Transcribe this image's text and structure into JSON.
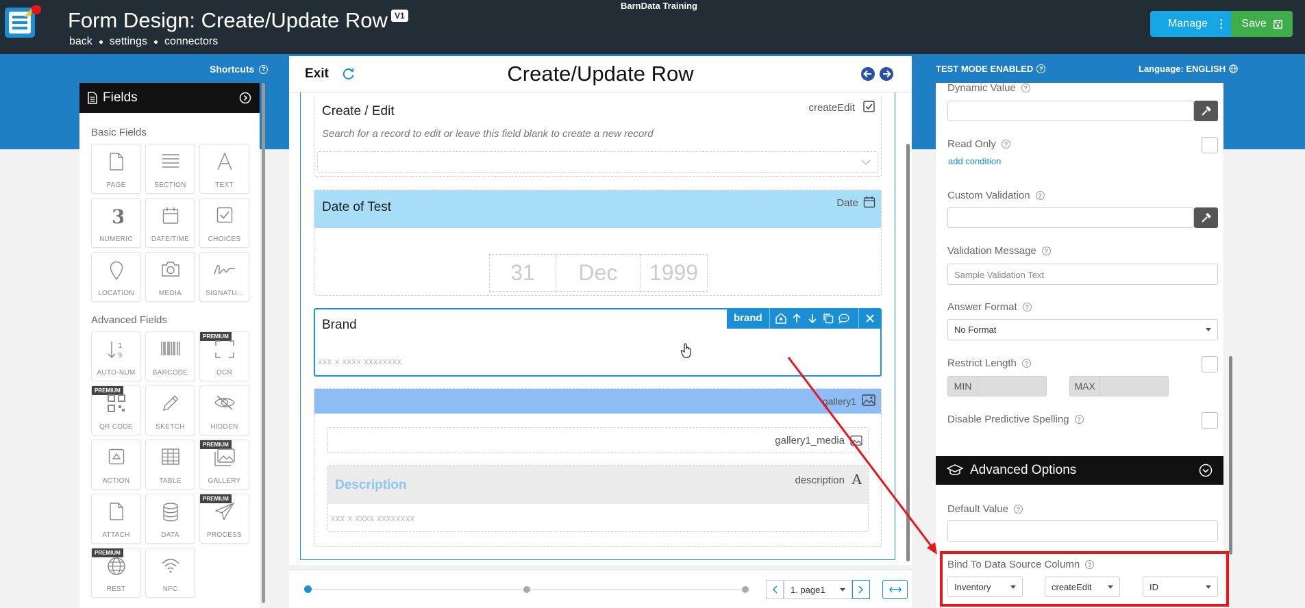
{
  "header": {
    "title": "Form Design: Create/Update Row",
    "version_badge": "V1",
    "links": [
      "back",
      "settings",
      "connectors"
    ],
    "org_name": "BarnData Training",
    "manage_label": "Manage",
    "save_label": "Save"
  },
  "bluebar": {
    "shortcuts_label": "Shortcuts",
    "test_mode_label": "TEST MODE ENABLED",
    "language_label": "Language: ENGLISH"
  },
  "fields_panel": {
    "title": "Fields",
    "basic_title": "Basic Fields",
    "basic_fields": [
      {
        "label": "PAGE",
        "icon": "page-icon"
      },
      {
        "label": "SECTION",
        "icon": "section-icon"
      },
      {
        "label": "TEXT",
        "icon": "text-icon"
      },
      {
        "label": "NUMERIC",
        "icon": "numeric-icon"
      },
      {
        "label": "DATE/TIME",
        "icon": "calendar-icon"
      },
      {
        "label": "CHOICES",
        "icon": "checkbox-icon"
      },
      {
        "label": "LOCATION",
        "icon": "location-pin-icon"
      },
      {
        "label": "MEDIA",
        "icon": "camera-icon"
      },
      {
        "label": "SIGNATU...",
        "icon": "signature-icon"
      }
    ],
    "advanced_title": "Advanced Fields",
    "premium_label": "PREMIUM",
    "advanced_fields": [
      {
        "label": "AUTO-NUM",
        "icon": "sort-numeric-icon",
        "premium": false
      },
      {
        "label": "BARCODE",
        "icon": "barcode-icon",
        "premium": false
      },
      {
        "label": "OCR",
        "icon": "ocr-scan-icon",
        "premium": true
      },
      {
        "label": "QR CODE",
        "icon": "qr-code-icon",
        "premium": true
      },
      {
        "label": "SKETCH",
        "icon": "pencil-icon",
        "premium": false
      },
      {
        "label": "HIDDEN",
        "icon": "eye-slash-icon",
        "premium": false
      },
      {
        "label": "ACTION",
        "icon": "action-icon",
        "premium": false
      },
      {
        "label": "TABLE",
        "icon": "table-icon",
        "premium": false
      },
      {
        "label": "GALLERY",
        "icon": "gallery-icon",
        "premium": true
      },
      {
        "label": "ATTACH",
        "icon": "file-icon",
        "premium": false
      },
      {
        "label": "DATA",
        "icon": "database-icon",
        "premium": false
      },
      {
        "label": "PROCESS",
        "icon": "paper-plane-icon",
        "premium": true
      },
      {
        "label": "REST",
        "icon": "globe-icon",
        "premium": true
      },
      {
        "label": "NFC",
        "icon": "nfc-icon",
        "premium": false
      }
    ]
  },
  "form": {
    "exit_label": "Exit",
    "title": "Create/Update Row",
    "fields": {
      "create_edit": {
        "title": "Create / Edit",
        "tag": "createEdit",
        "hint": "Search for a record to edit or leave this field blank to create a new record"
      },
      "date_of_test": {
        "title": "Date of Test",
        "tag": "Date",
        "day": "31",
        "month": "Dec",
        "year": "1999"
      },
      "brand": {
        "title": "Brand",
        "tag": "brand",
        "placeholder": "xxx x xxxx xxxxxxxx"
      },
      "gallery": {
        "tag": "gallery1",
        "media_tag": "gallery1_media"
      },
      "description": {
        "title": "Description",
        "tag": "description",
        "placeholder": "xxx x xxxx xxxxxxxx"
      }
    },
    "page_select": "1. page1"
  },
  "properties": {
    "dynamic_value_label": "Dynamic Value",
    "read_only_label": "Read Only",
    "add_condition_label": "add condition",
    "custom_validation_label": "Custom Validation",
    "validation_message_label": "Validation Message",
    "validation_message_placeholder": "Sample Validation Text",
    "answer_format_label": "Answer Format",
    "answer_format_value": "No Format",
    "restrict_length_label": "Restrict Length",
    "min_label": "MIN",
    "max_label": "MAX",
    "disable_spelling_label": "Disable Predictive Spelling",
    "advanced_title": "Advanced Options",
    "default_value_label": "Default Value",
    "bind_label": "Bind To Data Source Column",
    "bind_source": "Inventory",
    "bind_field": "createEdit",
    "bind_column": "ID"
  },
  "colors": {
    "highlight": "#e8151b",
    "accent": "#1a8fd6",
    "header": "#222d35"
  }
}
